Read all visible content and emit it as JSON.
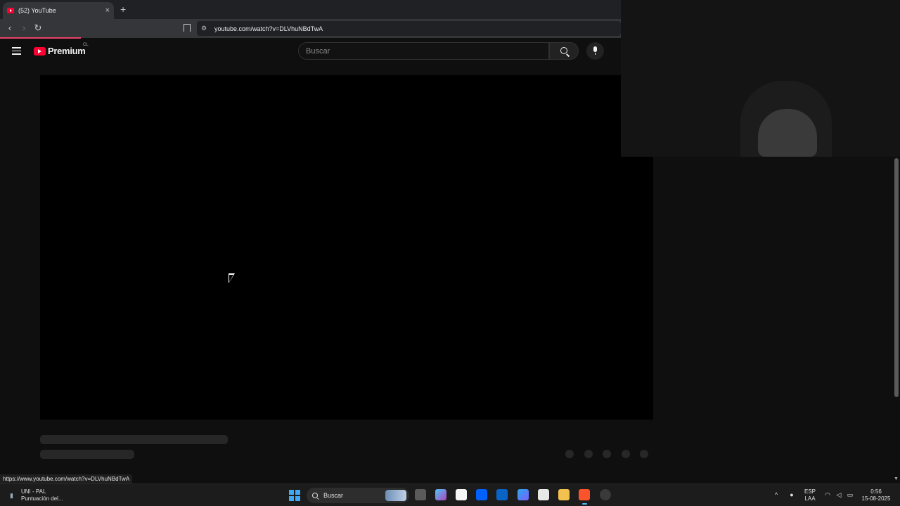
{
  "browser": {
    "tab": {
      "title": "(52) YouTube",
      "close": "×"
    },
    "new_tab": "+",
    "nav": {
      "back": "‹",
      "forward": "›",
      "reload": "↻"
    },
    "address": "youtube.com/watch?v=DLVhuNBdTwA",
    "status_link": "https://www.youtube.com/watch?v=DLVhuNBdTwA",
    "loading_progress": 0.13
  },
  "youtube": {
    "logo": {
      "word": "Premium",
      "country": "CL"
    },
    "search": {
      "placeholder": "Buscar"
    }
  },
  "taskbar": {
    "weather": {
      "line1": "UNI - PAL",
      "line2": "Puntuación del..."
    },
    "search": {
      "label": "Buscar"
    },
    "tray": {
      "lang1": "ESP",
      "lang2": "LAA",
      "time": "0:56",
      "date": "15-08-2025",
      "chevron": "^"
    }
  },
  "colors": {
    "accent": "#ff0033",
    "background": "#0f0f0f",
    "taskbar": "#1c1c1c"
  }
}
